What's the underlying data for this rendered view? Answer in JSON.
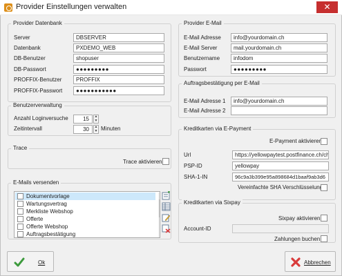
{
  "window": {
    "title": "Provider Einstellungen verwalten",
    "close_glyph": "✕"
  },
  "provider_db": {
    "title": "Provider Datenbank",
    "fields": [
      {
        "label": "Server",
        "value": "DBSERVER"
      },
      {
        "label": "Datenbank",
        "value": "PXDEMO_WEB"
      },
      {
        "label": "DB-Benutzer",
        "value": "shopuser"
      },
      {
        "label": "DB-Passwort",
        "value": "●●●●●●●●●"
      },
      {
        "label": "PROFFIX-Benutzer",
        "value": "PROFFIX"
      },
      {
        "label": "PROFFIX-Passwort",
        "value": "●●●●●●●●●●●"
      }
    ]
  },
  "provider_email": {
    "title": "Provider E-Mail",
    "fields": [
      {
        "label": "E-Mail Adresse",
        "value": "info@yourdomain.ch"
      },
      {
        "label": "E-Mail Server",
        "value": "mail.yourdomain.ch"
      },
      {
        "label": "Benutzername",
        "value": "infodom"
      },
      {
        "label": "Passwort",
        "value": "●●●●●●●●●"
      }
    ]
  },
  "user_mgmt": {
    "title": "Benutzerverwaltung",
    "login_label": "Anzahl Loginversuche",
    "login_value": "15",
    "interval_label": "Zeitintervall",
    "interval_value": "30",
    "interval_unit": "Minuten"
  },
  "order_confirm": {
    "title": "Auftragsbestätigung per E-Mail",
    "addr1_label": "E-Mail Adresse 1",
    "addr1_value": "info@yourdomain.ch",
    "addr2_label": "E-Mail Adresse 2",
    "addr2_value": ""
  },
  "trace": {
    "title": "Trace",
    "checkbox_label": "Trace aktivieren",
    "checked": false
  },
  "epayment": {
    "title": "Kreditkarten via E-Payment",
    "enable_label": "E-Payment aktivieren",
    "url_label": "Url",
    "url_value": "https://yellowpaytest.postfinance.ch/ch",
    "pspid_label": "PSP-ID",
    "pspid_value": "yellowpay",
    "sha_label": "SHA-1-IN",
    "sha_value": "96c9a3b399e95a898684d1baaf9ab3d6",
    "simple_sha_label": "Vereinfachte SHA Verschlüsselung"
  },
  "emails": {
    "title": "E-Mails versenden",
    "items": [
      "Dokumentvorlage",
      "Wartungsvertrag",
      "Merkliste Webshop",
      "Offerte",
      "Offerte Webshop",
      "Auftragsbestätigung"
    ],
    "selected_index": 0
  },
  "sixpay": {
    "title": "Kreditkarten via Sixpay",
    "enable_label": "Sixpay aktivieren",
    "account_label": "Account-ID",
    "account_value": "",
    "booking_label": "Zahlungen buchen"
  },
  "buttons": {
    "ok": "Ok",
    "cancel": "Abbrechen"
  },
  "colors": {
    "close": "#c62f2f",
    "selection": "#cde8fb",
    "ok_icon": "#3c9a3c",
    "cancel_icon": "#d93a3a"
  }
}
